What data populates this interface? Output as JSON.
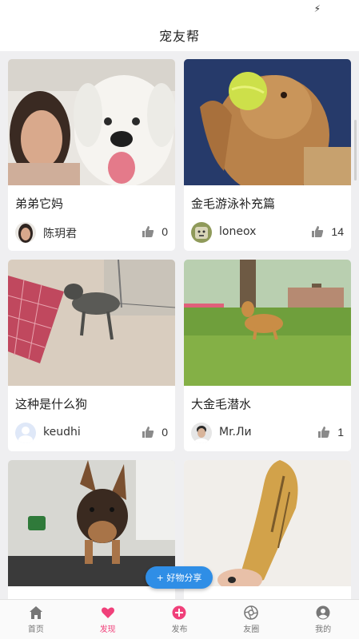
{
  "status_bar": {
    "icon": "lightning-icon"
  },
  "header": {
    "title": "宠友帮"
  },
  "posts": [
    {
      "title": "弟弟它妈",
      "author": "陈玥君",
      "likes": "0"
    },
    {
      "title": "金毛游泳补充篇",
      "author": "loneox",
      "likes": "14"
    },
    {
      "title": "这种是什么狗",
      "author": "keudhi",
      "likes": "0"
    },
    {
      "title": "大金毛潜水",
      "author": "Mr.Ли",
      "likes": "1"
    }
  ],
  "share_button": {
    "label": "+ 好物分享"
  },
  "tabs": [
    {
      "label": "首页",
      "icon": "home-icon"
    },
    {
      "label": "发现",
      "icon": "heart-icon",
      "active": true
    },
    {
      "label": "发布",
      "icon": "plus-circle-icon"
    },
    {
      "label": "友圈",
      "icon": "aperture-icon"
    },
    {
      "label": "我的",
      "icon": "profile-icon"
    }
  ],
  "colors": {
    "accent": "#f0407a",
    "share": "#2f8ee6",
    "background": "#efeff1"
  }
}
